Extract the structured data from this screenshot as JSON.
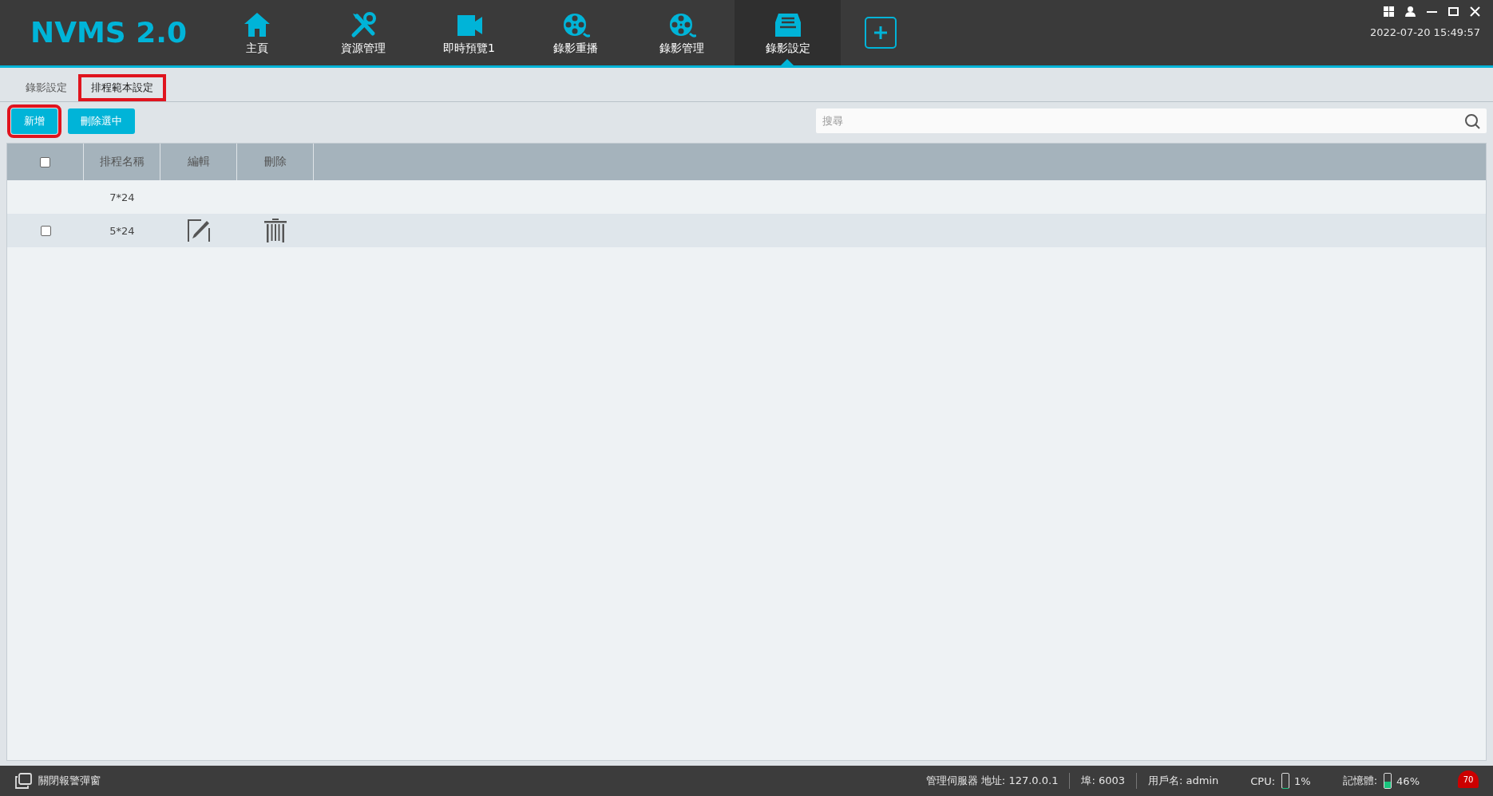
{
  "app": {
    "logo": "NVMS 2.0",
    "datetime": "2022-07-20 15:49:57"
  },
  "nav": [
    {
      "label": "主頁",
      "kind": "home",
      "selected": false
    },
    {
      "label": "資源管理",
      "kind": "tools",
      "selected": false
    },
    {
      "label": "即時預覽1",
      "kind": "camera",
      "selected": false
    },
    {
      "label": "錄影重播",
      "kind": "reel",
      "selected": false
    },
    {
      "label": "錄影管理",
      "kind": "reel",
      "selected": false
    },
    {
      "label": "錄影設定",
      "kind": "tray",
      "selected": true
    }
  ],
  "tabs": [
    {
      "label": "錄影設定",
      "selected": false,
      "highlighted": false
    },
    {
      "label": "排程範本設定",
      "selected": true,
      "highlighted": true
    }
  ],
  "toolbar": {
    "buttons": [
      {
        "label": "新增",
        "highlighted": true
      },
      {
        "label": "刪除選中",
        "highlighted": false
      }
    ],
    "search": {
      "placeholder": "搜尋"
    }
  },
  "table": {
    "select_all_checked": false,
    "columns": [
      "排程名稱",
      "編輯",
      "刪除"
    ],
    "rows": [
      {
        "name": "7*24",
        "editable": false
      },
      {
        "name": "5*24",
        "editable": true,
        "checked": false
      }
    ]
  },
  "status_bar": {
    "alarm_popup": "關閉報警彈窗",
    "server": "管理伺服器 地址: 127.0.0.1",
    "port": "埠: 6003",
    "user": "用戶名: admin",
    "cpu_label": "CPU:",
    "cpu": {
      "level": 0.01
    },
    "cpu_reading": "1%",
    "memory_label": "記憶體:",
    "memory": {
      "level": 0.46
    },
    "memory_reading": "46%",
    "alarm_count": "70"
  }
}
